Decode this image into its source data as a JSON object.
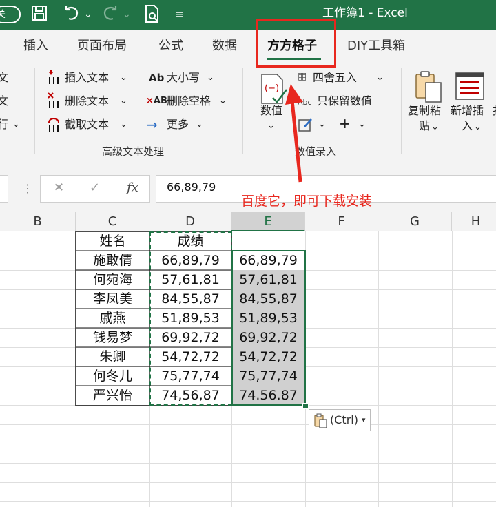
{
  "titlebar": {
    "title": "工作簿1 - Excel",
    "autosave": "关",
    "icons": [
      "autosave-toggle",
      "save-icon",
      "undo-icon",
      "redo-icon",
      "print-preview-icon",
      "customize-icon"
    ]
  },
  "tabs": [
    "插入",
    "页面布局",
    "公式",
    "数据",
    "方方格子",
    "DIY工具箱"
  ],
  "active_tab": "方方格子",
  "ribbon": {
    "left_partial": [
      "文",
      "文",
      "行"
    ],
    "text_group": {
      "items": [
        "插入文本",
        "删除文本",
        "截取文本",
        "大小写",
        "删除空格",
        "更多"
      ],
      "label": "高级文本处理"
    },
    "number_group": {
      "big_button": "数值",
      "items": [
        "四舍五入",
        "只保留数值"
      ],
      "label": "数值录入"
    },
    "right_group": {
      "copy_paste": "复制粘\n贴",
      "new_insert": "新增插\n入"
    }
  },
  "formula_bar": {
    "cancel": "✕",
    "enter": "✓",
    "fx": "fx",
    "value": "66,89,79"
  },
  "annotation": "百度它，即可下载安装",
  "columns": [
    "B",
    "C",
    "D",
    "E",
    "F",
    "G",
    "H"
  ],
  "selected_column": "E",
  "table": {
    "header": [
      "姓名",
      "成绩"
    ],
    "rows": [
      {
        "name": "施敢倩",
        "score": "66,89,79",
        "copy": "66,89,79"
      },
      {
        "name": "何宛海",
        "score": "57,61,81",
        "copy": "57,61,81"
      },
      {
        "name": "李凤美",
        "score": "84,55,87",
        "copy": "84,55,87"
      },
      {
        "name": "戚燕",
        "score": "51,89,53",
        "copy": "51,89,53"
      },
      {
        "name": "钱易梦",
        "score": "69,92,72",
        "copy": "69,92,72"
      },
      {
        "name": "朱卿",
        "score": "54,72,72",
        "copy": "54,72,72"
      },
      {
        "name": "何冬儿",
        "score": "75,77,74",
        "copy": "75,77,74"
      },
      {
        "name": "严兴怡",
        "score": "74,56,87",
        "copy": "74.56.87"
      }
    ]
  },
  "paste_options": "(Ctrl)",
  "colors": {
    "excel_green": "#217346",
    "highlight_red": "#e8271e",
    "selection_gray": "#d0d0d0"
  }
}
